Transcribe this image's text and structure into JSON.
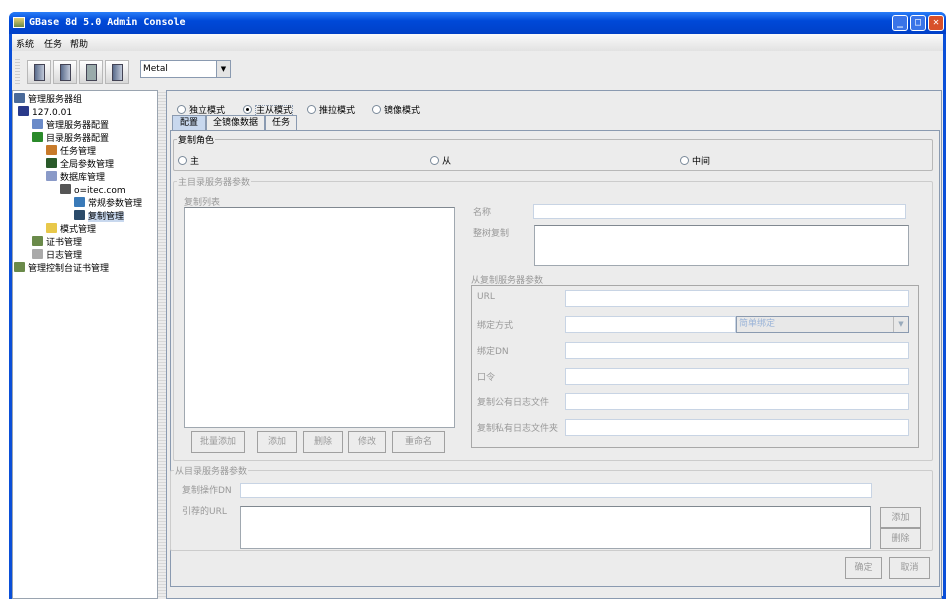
{
  "window": {
    "title": "GBase 8d 5.0 Admin Console",
    "min": "_",
    "max": "□",
    "close": "✕"
  },
  "menu": [
    "系统",
    "任务",
    "帮助"
  ],
  "toolbar": {
    "icons": [
      "server-users-icon",
      "server-refresh-icon",
      "server-settings-icon",
      "server-help-icon"
    ],
    "theme": "Metal"
  },
  "tree": [
    {
      "label": "管理服务器组",
      "depth": 0,
      "color": "#4a6a9a"
    },
    {
      "label": "127.0.01",
      "depth": 1,
      "color": "#2a3a8a"
    },
    {
      "label": "管理服务器配置",
      "depth": 2,
      "color": "#6a8ac8"
    },
    {
      "label": "目录服务器配置",
      "depth": 2,
      "color": "#2a8a2a"
    },
    {
      "label": "任务管理",
      "depth": 3,
      "color": "#c87a2a"
    },
    {
      "label": "全局参数管理",
      "depth": 3,
      "color": "#2a5a2a"
    },
    {
      "label": "数据库管理",
      "depth": 3,
      "color": "#8a9ac8"
    },
    {
      "label": "o=itec.com",
      "depth": 4,
      "color": "#555"
    },
    {
      "label": "常规参数管理",
      "depth": 5,
      "color": "#3a7ab8"
    },
    {
      "label": "复制管理",
      "depth": 5,
      "color": "#2a4a6a",
      "selected": true
    },
    {
      "label": "模式管理",
      "depth": 3,
      "color": "#e8c84a"
    },
    {
      "label": "证书管理",
      "depth": 2,
      "color": "#6a8a4a"
    },
    {
      "label": "日志管理",
      "depth": 2,
      "color": "#aaa"
    },
    {
      "label": "管理控制台证书管理",
      "depth": 0,
      "color": "#6a8a4a"
    }
  ],
  "modes": [
    {
      "label": "独立模式",
      "checked": false
    },
    {
      "label": "主从模式",
      "checked": true
    },
    {
      "label": "推拉模式",
      "checked": false
    },
    {
      "label": "镜像模式",
      "checked": false
    }
  ],
  "tabs": [
    "配置",
    "全镜像数据",
    "任务"
  ],
  "role": {
    "title": "复制角色",
    "options": [
      "主",
      "从",
      "中间"
    ]
  },
  "master": {
    "title": "主目录服务器参数",
    "list_label": "复制列表",
    "buttons": [
      "批量添加",
      "添加",
      "删除",
      "修改",
      "重命名"
    ],
    "name_label": "名称",
    "subtree_label": "整树复制",
    "slave": {
      "title": "从复制服务器参数",
      "url": "URL",
      "bind_method": "绑定方式",
      "bind_option": "简单绑定",
      "bind_dn": "绑定DN",
      "password": "口令",
      "public_log": "复制公有日志文件",
      "private_log": "复制私有日志文件夹"
    }
  },
  "slave_dir": {
    "title": "从目录服务器参数",
    "op_dn": "复制操作DN",
    "referral": "引荐的URL",
    "add": "添加",
    "delete": "删除"
  },
  "footer": {
    "ok": "确定",
    "cancel": "取消"
  }
}
